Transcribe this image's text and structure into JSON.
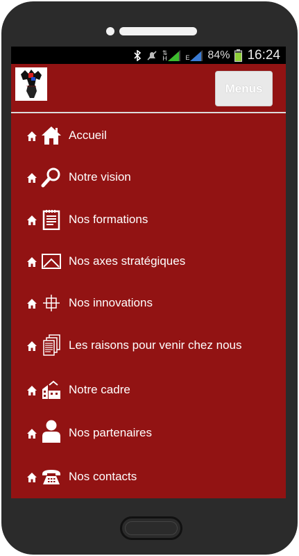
{
  "status_bar": {
    "battery_percent": "84%",
    "time": "16:24",
    "network_h": "H",
    "network_e": "E",
    "icons": [
      "bluetooth-icon",
      "mute-icon",
      "signal-h-icon",
      "signal-e-icon",
      "battery-icon"
    ]
  },
  "header": {
    "menu_button_label": "Menus",
    "logo_icon": "school-logo-icon"
  },
  "menu": {
    "items": [
      {
        "label": "Accueil",
        "icon": "house-icon"
      },
      {
        "label": "Notre vision",
        "icon": "magnifier-icon"
      },
      {
        "label": "Nos formations",
        "icon": "notepad-icon"
      },
      {
        "label": "Nos axes stratégiques",
        "icon": "mountain-frame-icon"
      },
      {
        "label": "Nos innovations",
        "icon": "crosshair-icon"
      },
      {
        "label": "Les raisons pour venir chez nous",
        "icon": "documents-icon"
      },
      {
        "label": "Notre cadre",
        "icon": "building-icon"
      },
      {
        "label": "Nos partenaires",
        "icon": "person-icon"
      },
      {
        "label": "Nos contacts",
        "icon": "telephone-icon"
      }
    ],
    "bullet_icon": "home-bullet-icon"
  },
  "colors": {
    "background": "#921313",
    "text": "#ffffff",
    "status_bar": "#000000",
    "signal_green": "#3dbb2e",
    "signal_blue": "#3a7bd5"
  }
}
